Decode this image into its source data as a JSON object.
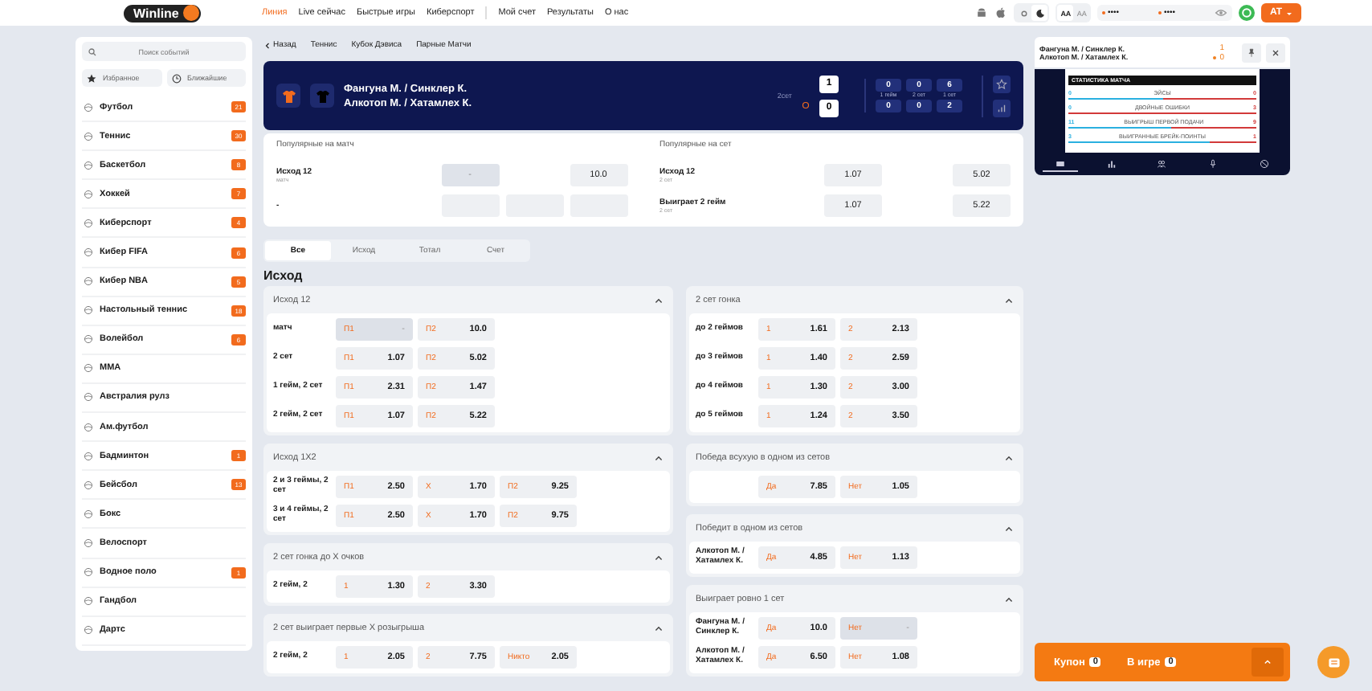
{
  "top_nav": {
    "logo": "Winline",
    "links": [
      {
        "label": "Линия",
        "selected": true
      },
      {
        "label": "Live сейчас",
        "selected": false
      },
      {
        "label": "Быстрые игры",
        "selected": false
      },
      {
        "label": "Киберспорт",
        "selected": false
      }
    ],
    "account_links": [
      "Мой счет",
      "Результаты",
      "О нас"
    ],
    "themes": [
      {
        "kind": "light",
        "selected": false
      },
      {
        "kind": "dark",
        "selected": true
      }
    ],
    "font_sizes": [
      {
        "label": "AA",
        "selected": true
      },
      {
        "label": "AA",
        "selected": false
      }
    ],
    "login_fields": [
      {
        "value": "••••"
      },
      {
        "value": "••••"
      }
    ],
    "user_button": "AT"
  },
  "sidebar": {
    "search_placeholder": "Поиск событий",
    "quick_links": [
      "Избранное",
      "Ближайшие"
    ],
    "sports": [
      {
        "name": "Футбол",
        "count": "21"
      },
      {
        "name": "Теннис",
        "count": "30"
      },
      {
        "name": "Баскетбол",
        "count": "8"
      },
      {
        "name": "Хоккей",
        "count": "7"
      },
      {
        "name": "Киберспорт",
        "count": "4"
      },
      {
        "name": "Кибер FIFA",
        "count": "6"
      },
      {
        "name": "Кибер NBA",
        "count": "5"
      },
      {
        "name": "Настольный теннис",
        "count": "18"
      },
      {
        "name": "Волейбол",
        "count": "6"
      },
      {
        "name": "MMA"
      },
      {
        "name": "Австралия рулз"
      },
      {
        "name": "Ам.футбол"
      },
      {
        "name": "Бадминтон",
        "count": "1"
      },
      {
        "name": "Бейсбол",
        "count": "13"
      },
      {
        "name": "Бокс"
      },
      {
        "name": "Велоспорт"
      },
      {
        "name": "Водное поло",
        "count": "1"
      },
      {
        "name": "Гандбол"
      },
      {
        "name": "Дартс"
      }
    ]
  },
  "breadcrumb": {
    "back": "Назад",
    "items": [
      "Теннис",
      "Кубок Дэвиса",
      "Парные Матчи"
    ]
  },
  "match": {
    "team_1": "Фангуна М. / Синклер К.",
    "team_2": "Алкотоп М. / Хатамлех К.",
    "period": "2сет",
    "score_1": "1",
    "score_2": "0",
    "team_2_serving": true,
    "columns": [
      {
        "label": "1 гейм",
        "score_1": "0",
        "score_2": "0"
      },
      {
        "label": "2 сет",
        "score_1": "0",
        "score_2": "0"
      },
      {
        "label": "1 сет",
        "score_1": "6",
        "score_2": "2"
      }
    ]
  },
  "popular": [
    {
      "title": "Популярные на матч",
      "rows": [
        {
          "name": "Исход 12",
          "sub": "матч",
          "cells": [
            {
              "kind": "locked",
              "text": "-"
            },
            {
              "kind": "gap"
            },
            {
              "kind": "odd",
              "text": "10.0"
            }
          ]
        },
        {
          "name": "-",
          "cells": [
            {
              "kind": "empty"
            },
            {
              "kind": "empty"
            },
            {
              "kind": "empty"
            }
          ]
        }
      ]
    },
    {
      "title": "Популярные на сет",
      "rows": [
        {
          "name": "Исход 12",
          "sub": "2 сет",
          "cells": [
            {
              "kind": "odd",
              "text": "1.07"
            },
            {
              "kind": "gap"
            },
            {
              "kind": "odd",
              "text": "5.02"
            }
          ]
        },
        {
          "name": "Выиграет 2 гейм",
          "sub": "2 сет",
          "cells": [
            {
              "kind": "odd",
              "text": "1.07"
            },
            {
              "kind": "gap"
            },
            {
              "kind": "odd",
              "text": "5.22"
            }
          ]
        }
      ]
    }
  ],
  "market_tabs": [
    {
      "label": "Все",
      "selected": true
    },
    {
      "label": "Исход",
      "selected": false
    },
    {
      "label": "Тотал",
      "selected": false
    },
    {
      "label": "Счет",
      "selected": false
    }
  ],
  "section_title": "Исход",
  "market_columns": [
    [
      {
        "title": "Исход 12",
        "expanded": true,
        "rows": [
          {
            "label": "матч",
            "bets": [
              {
                "label": "П1",
                "odd": "-",
                "locked": true
              },
              {
                "label": "П2",
                "odd": "10.0",
                "locked": false
              }
            ]
          },
          {
            "label": "2 сет",
            "bets": [
              {
                "label": "П1",
                "odd": "1.07",
                "locked": false
              },
              {
                "label": "П2",
                "odd": "5.02",
                "locked": false
              }
            ]
          },
          {
            "label": "1 гейм, 2 сет",
            "bets": [
              {
                "label": "П1",
                "odd": "2.31",
                "locked": false
              },
              {
                "label": "П2",
                "odd": "1.47",
                "locked": false
              }
            ]
          },
          {
            "label": "2 гейм, 2 сет",
            "bets": [
              {
                "label": "П1",
                "odd": "1.07",
                "locked": false
              },
              {
                "label": "П2",
                "odd": "5.22",
                "locked": false
              }
            ]
          }
        ]
      },
      {
        "title": "Исход 1X2",
        "expanded": true,
        "rows": [
          {
            "label": "2 и 3 геймы, 2 сет",
            "bets": [
              {
                "label": "П1",
                "odd": "2.50",
                "locked": false
              },
              {
                "label": "X",
                "odd": "1.70",
                "locked": false
              },
              {
                "label": "П2",
                "odd": "9.25",
                "locked": false
              }
            ]
          },
          {
            "label": "3 и 4 геймы, 2 сет",
            "bets": [
              {
                "label": "П1",
                "odd": "2.50",
                "locked": false
              },
              {
                "label": "X",
                "odd": "1.70",
                "locked": false
              },
              {
                "label": "П2",
                "odd": "9.75",
                "locked": false
              }
            ]
          }
        ]
      },
      {
        "title": "2 сет гонка до X очков",
        "expanded": true,
        "rows": [
          {
            "label": "2 гейм, 2",
            "bets": [
              {
                "label": "1",
                "odd": "1.30",
                "locked": false
              },
              {
                "label": "2",
                "odd": "3.30",
                "locked": false
              }
            ]
          }
        ]
      },
      {
        "title": "2 сет выиграет первые X розыгрыша",
        "expanded": true,
        "rows": [
          {
            "label": "2 гейм, 2",
            "bets": [
              {
                "label": "1",
                "odd": "2.05",
                "locked": false
              },
              {
                "label": "2",
                "odd": "7.75",
                "locked": false
              },
              {
                "label": "Никто",
                "odd": "2.05",
                "locked": false
              }
            ]
          }
        ]
      }
    ],
    [
      {
        "title": "2 сет гонка",
        "expanded": true,
        "rows": [
          {
            "label": "до 2 геймов",
            "bets": [
              {
                "label": "1",
                "odd": "1.61",
                "locked": false
              },
              {
                "label": "2",
                "odd": "2.13",
                "locked": false
              }
            ]
          },
          {
            "label": "до 3 геймов",
            "bets": [
              {
                "label": "1",
                "odd": "1.40",
                "locked": false
              },
              {
                "label": "2",
                "odd": "2.59",
                "locked": false
              }
            ]
          },
          {
            "label": "до 4 геймов",
            "bets": [
              {
                "label": "1",
                "odd": "1.30",
                "locked": false
              },
              {
                "label": "2",
                "odd": "3.00",
                "locked": false
              }
            ]
          },
          {
            "label": "до 5 геймов",
            "bets": [
              {
                "label": "1",
                "odd": "1.24",
                "locked": false
              },
              {
                "label": "2",
                "odd": "3.50",
                "locked": false
              }
            ]
          }
        ]
      },
      {
        "title": "Победа всухую в одном из сетов",
        "expanded": true,
        "rows": [
          {
            "bets": [
              {
                "label": "Да",
                "odd": "7.85",
                "locked": false
              },
              {
                "label": "Нет",
                "odd": "1.05",
                "locked": false
              }
            ]
          }
        ]
      },
      {
        "title": "Победит в одном из сетов",
        "expanded": true,
        "rows": [
          {
            "label": "Алкотоп М. / Хатамлех К.",
            "bets": [
              {
                "label": "Да",
                "odd": "4.85",
                "locked": false
              },
              {
                "label": "Нет",
                "odd": "1.13",
                "locked": false
              }
            ]
          }
        ]
      },
      {
        "title": "Выиграет ровно 1 сет",
        "expanded": true,
        "rows": [
          {
            "label": "Фангуна М. / Синклер К.",
            "bets": [
              {
                "label": "Да",
                "odd": "10.0",
                "locked": false
              },
              {
                "label": "Нет",
                "odd": "-",
                "locked": true
              }
            ]
          },
          {
            "label": "Алкотоп М. / Хатамлех К.",
            "bets": [
              {
                "label": "Да",
                "odd": "6.50",
                "locked": false
              },
              {
                "label": "Нет",
                "odd": "1.08",
                "locked": false
              }
            ]
          }
        ]
      }
    ]
  ],
  "mini_score": {
    "team_1": "Фангуна М. / Синклер К.",
    "team_2": "Алкотоп М. / Хатамлех К.",
    "score_1": "1",
    "score_2": "0"
  },
  "stats": {
    "title": "СТАТИСТИКА МАТЧА",
    "rows": [
      {
        "name": "ЭЙСЫ",
        "value_1": "0",
        "value_2": "0",
        "level": 0.5
      },
      {
        "name": "ДВОЙНЫЕ ОШИБКИ",
        "value_1": "0",
        "value_2": "3",
        "level": 0
      },
      {
        "name": "ВЫИГРЫШ ПЕРВОЙ ПОДАЧИ",
        "value_1": "11",
        "value_2": "9",
        "level": 0.55
      },
      {
        "name": "ВЫИГРАННЫЕ БРЕЙК-ПОИНТЫ",
        "value_1": "3",
        "value_2": "1",
        "level": 0.75
      }
    ],
    "tabs": [
      {
        "kind": "scoreboard",
        "selected": true
      },
      {
        "kind": "chart",
        "selected": false
      },
      {
        "kind": "people",
        "selected": false
      },
      {
        "kind": "mic",
        "selected": false
      },
      {
        "kind": "ball",
        "selected": false
      }
    ]
  },
  "coupon": {
    "label": "Купон",
    "count": "0",
    "live_label": "В игре",
    "live_count": "0"
  }
}
